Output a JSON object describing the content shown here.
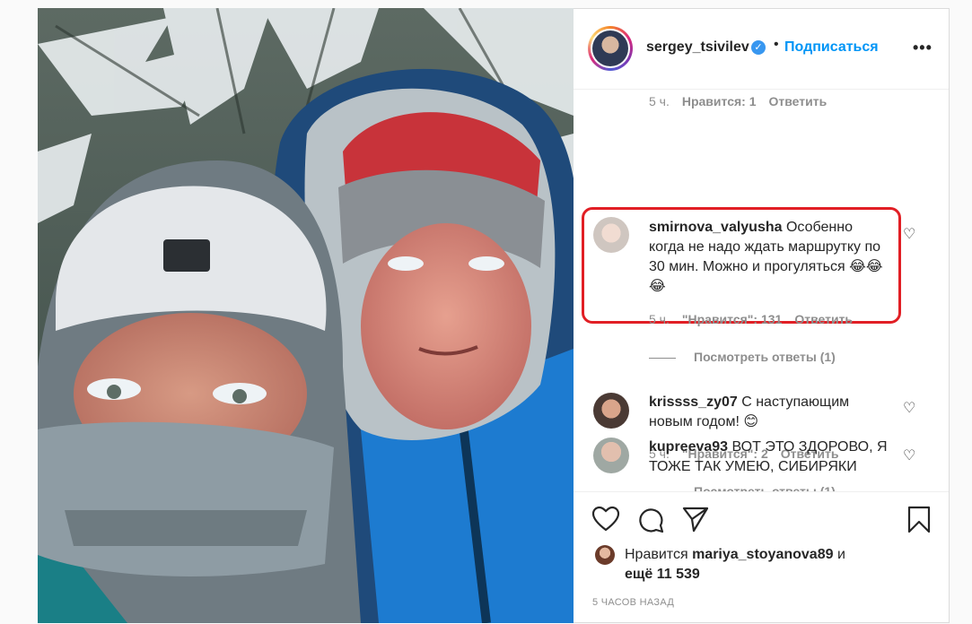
{
  "header": {
    "username": "sergey_tsivilev",
    "verified_mark": "✓",
    "separator": "•",
    "follow_label": "Подписаться",
    "more_label": "•••"
  },
  "top_meta": {
    "time": "5 ч.",
    "likes": "Нравится: 1",
    "reply": "Ответить"
  },
  "comments": [
    {
      "username": "smirnova_valyusha",
      "text": "Особенно когда не надо ждать маршрутку по 30 мин. Можно и прогуляться 😂😂😂",
      "time": "5 ч.",
      "likes": "\"Нравится\": 131",
      "reply": "Ответить",
      "view_replies": "Посмотреть ответы (1)"
    },
    {
      "username": "krissss_zy07",
      "text": "С наступающим новым годом! 😊",
      "time": "5 ч.",
      "likes": "\"Нравится\": 2",
      "reply": "Ответить",
      "view_replies": "Посмотреть ответы (1)"
    },
    {
      "username": "kupreeva93",
      "text": "ВОТ ЭТО ЗДОРОВО, Я ТОЖЕ ТАК УМЕЮ, СИБИРЯКИ"
    }
  ],
  "likes_line": {
    "prefix": "Нравится",
    "username": "mariya_stoyanova89",
    "suffix": "и",
    "count": "ещё 11 539"
  },
  "timestamp": "5 ЧАСОВ НАЗАД",
  "icons": [
    "heart-icon",
    "comment-icon",
    "share-icon",
    "bookmark-icon",
    "more-icon",
    "verified-icon"
  ],
  "colors": {
    "accent": "#0095f6",
    "highlight": "#e11f25",
    "muted": "#8e8e8e",
    "text": "#262626"
  }
}
